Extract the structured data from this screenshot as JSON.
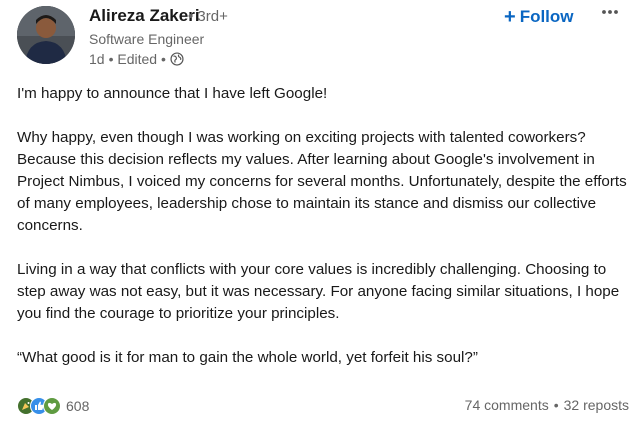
{
  "author": {
    "name": "Alireza Zakeri",
    "degree": "• 3rd+",
    "headline": "Software Engineer",
    "time": "1d",
    "edited": "• Edited •"
  },
  "actions": {
    "follow_label": "Follow",
    "follow_icon": "plus-icon",
    "more_icon": "more-options-icon"
  },
  "post": {
    "paragraphs": [
      "I'm happy to announce that I have left Google!",
      "Why happy, even though I was working on exciting projects with talented coworkers? Because this decision reflects my values. After learning about Google's involvement in Project Nimbus, I voiced my concerns for several months. Unfortunately, despite the efforts of many employees, leadership chose to maintain its stance and dismiss our collective concerns.",
      "Living in a way that conflicts with your core values is incredibly challenging. Choosing to step away was not easy, but it was necessary. For anyone facing similar situations, I hope you find the courage to prioritize your principles.",
      "“What good is it for man to gain the whole world, yet forfeit his soul?”"
    ]
  },
  "social": {
    "reaction_count": "608",
    "reaction_icons": [
      "celebrate-icon",
      "like-icon",
      "support-icon"
    ],
    "comments": "74 comments",
    "separator": "•",
    "reposts": "32 reposts"
  },
  "colors": {
    "accent": "#0a66c2",
    "text": "#191919",
    "secondary": "#666666"
  }
}
